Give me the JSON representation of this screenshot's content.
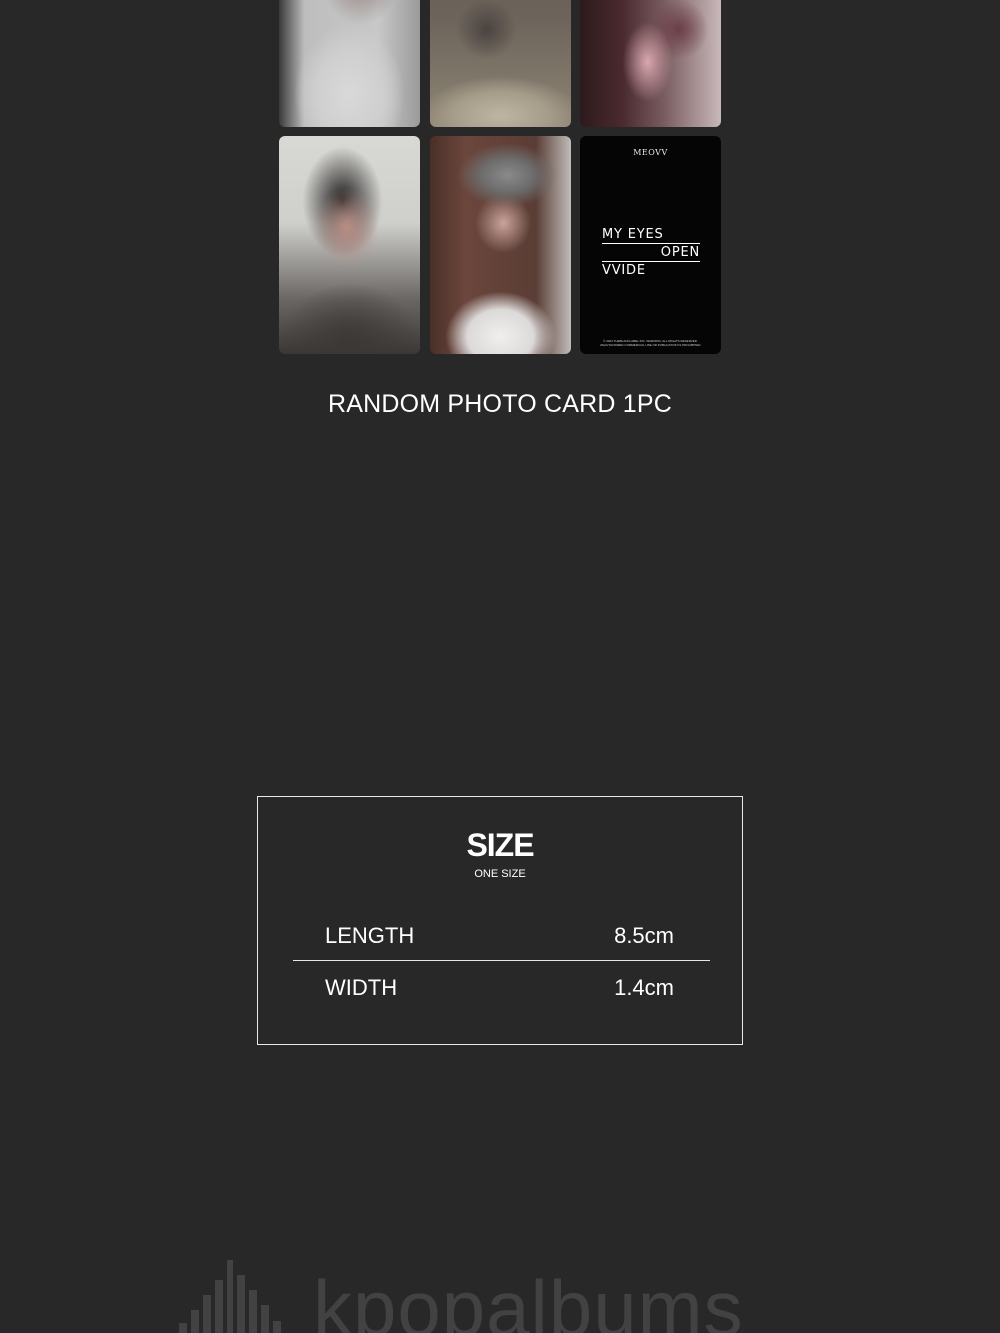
{
  "photo_cards": [
    {
      "kind": "blurred-photo"
    },
    {
      "kind": "blurred-photo"
    },
    {
      "kind": "blurred-photo"
    },
    {
      "kind": "blurred-photo"
    },
    {
      "kind": "blurred-photo"
    },
    {
      "kind": "text-card",
      "brand": "MEOVV",
      "title_lines": [
        "MY EYES",
        "OPEN",
        "VVIDE"
      ],
      "fine_print": "© 2024 THEBLACKLABEL INC. WARNING: ALL RIGHTS RESERVED. UNAUTHORIZED COMMERCIAL USE OR PUBLICATION IS PROHIBITED."
    }
  ],
  "caption": "RANDOM PHOTO CARD 1PC",
  "size_table": {
    "title": "SIZE",
    "subtitle": "ONE SIZE",
    "rows": [
      {
        "label": "LENGTH",
        "value": "8.5cm"
      },
      {
        "label": "WIDTH",
        "value": "1.4cm"
      }
    ]
  },
  "watermark": {
    "text": "kpopalbums",
    "icon": "city-skyline-icon"
  },
  "colors": {
    "background": "#282828",
    "text": "#ffffff",
    "border": "#e8e8e8"
  }
}
